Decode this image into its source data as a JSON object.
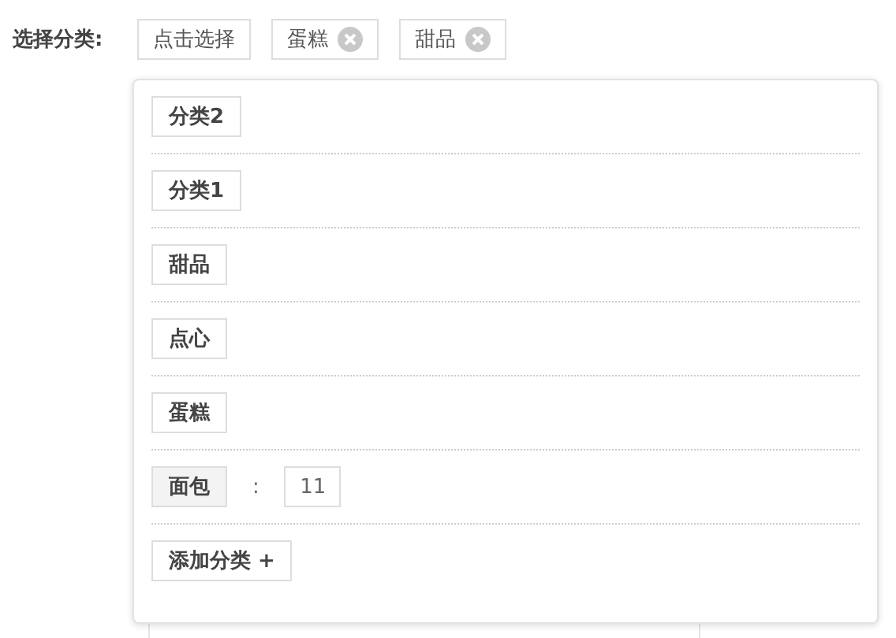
{
  "form_label": "选择分类:",
  "chosen": [
    {
      "kind": "button",
      "label": "点击选择"
    },
    {
      "kind": "tag",
      "label": "蛋糕"
    },
    {
      "kind": "tag",
      "label": "甜品"
    }
  ],
  "dropdown": {
    "items": [
      {
        "label": "分类2",
        "selected": false
      },
      {
        "label": "分类1",
        "selected": false
      },
      {
        "label": "甜品",
        "selected": false
      },
      {
        "label": "点心",
        "selected": false
      },
      {
        "label": "蛋糕",
        "selected": false
      },
      {
        "label": "面包",
        "selected": true,
        "separator": ":",
        "value": "11"
      }
    ],
    "add_button": "添加分类 +"
  }
}
